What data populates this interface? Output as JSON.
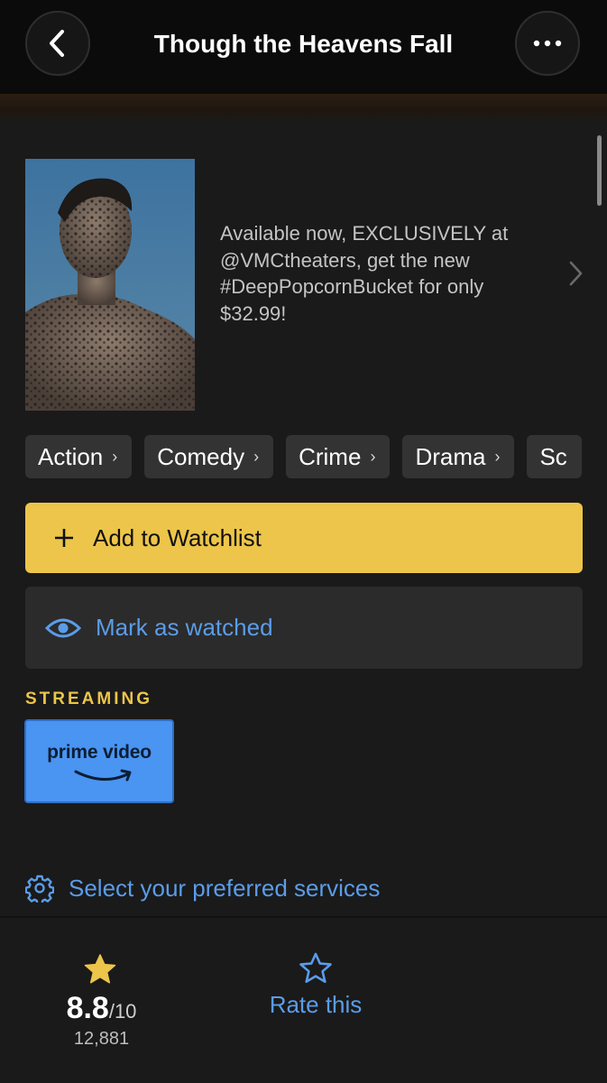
{
  "header": {
    "title": "Though the Heavens Fall",
    "back_icon": "chevron-left-icon",
    "more_icon": "more-horizontal-icon"
  },
  "promo": {
    "description": "Available now, EXCLUSIVELY at @VMCtheaters, get the new #DeepPopcornBucket for only $32.99!"
  },
  "genres": [
    {
      "label": "Action"
    },
    {
      "label": "Comedy"
    },
    {
      "label": "Crime"
    },
    {
      "label": "Drama"
    },
    {
      "label": "Sc"
    }
  ],
  "actions": {
    "watchlist_label": "Add to Watchlist",
    "watched_label": "Mark as watched"
  },
  "streaming": {
    "section_label": "STREAMING",
    "service_logo_text": "prime video"
  },
  "services": {
    "label": "Select your preferred services"
  },
  "rating": {
    "value": "8.8",
    "scale": "/10",
    "count": "12,881",
    "rate_label": "Rate this"
  },
  "colors": {
    "accent_yellow": "#ecc54a",
    "link_blue": "#5b9ce8",
    "prime_blue": "#4a94f2",
    "background": "#1a1a1a"
  }
}
